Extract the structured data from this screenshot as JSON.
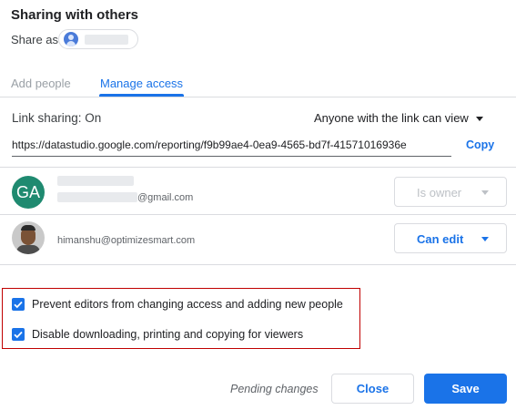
{
  "dialog": {
    "title": "Sharing with others",
    "share_as_label": "Share as"
  },
  "tabs": [
    {
      "label": "Add people",
      "active": false
    },
    {
      "label": "Manage access",
      "active": true
    }
  ],
  "link_sharing": {
    "status": "Link sharing: On",
    "access_option": "Anyone with the link can view",
    "url": "https://datastudio.google.com/reporting/f9b99ae4-0ea9-4565-bd7f-41571016936e",
    "copy_label": "Copy"
  },
  "people": [
    {
      "avatar_initials": "GA",
      "email_suffix": "@gmail.com",
      "role": "Is owner",
      "role_enabled": false
    },
    {
      "avatar_icon": "user-photo",
      "email": "himanshu@optimizesmart.com",
      "role": "Can edit",
      "role_enabled": true
    }
  ],
  "options": [
    {
      "label": "Prevent editors from changing access and adding new people",
      "checked": true
    },
    {
      "label": "Disable downloading, printing and copying for viewers",
      "checked": true
    }
  ],
  "footer": {
    "status": "Pending changes",
    "close_label": "Close",
    "save_label": "Save"
  },
  "colors": {
    "accent": "#1a73e8",
    "highlight_border": "#c00000",
    "owner_avatar": "#1f8a70"
  }
}
